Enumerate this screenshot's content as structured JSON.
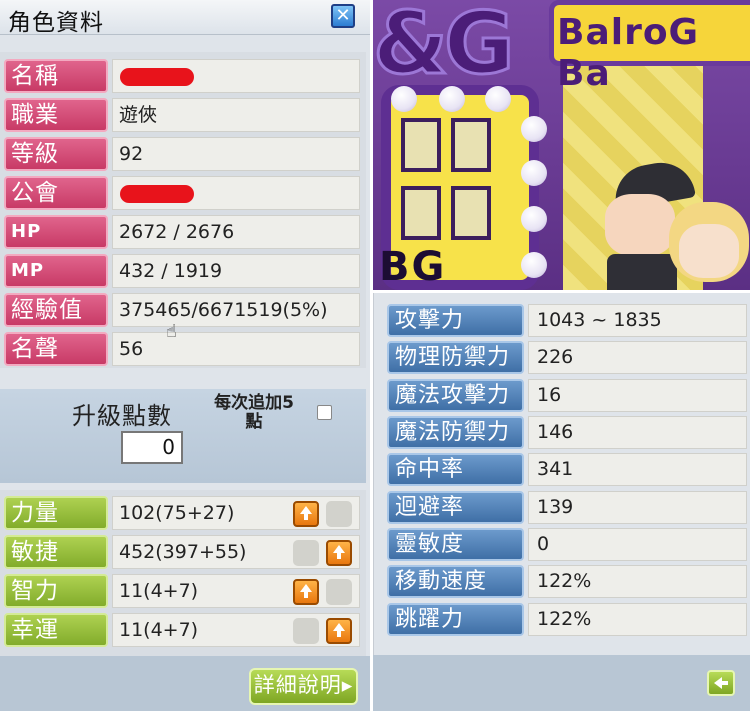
{
  "window": {
    "title": "角色資料"
  },
  "info": [
    {
      "label": "名稱",
      "value": "",
      "redacted": true
    },
    {
      "label": "職業",
      "value": "遊俠"
    },
    {
      "label": "等級",
      "value": "92"
    },
    {
      "label": "公會",
      "value": "",
      "redacted": true
    },
    {
      "label": "HP",
      "value": "2672 / 2676"
    },
    {
      "label": "MP",
      "value": "432 / 1919"
    },
    {
      "label": "經驗值",
      "value": "375465/6671519(5%)"
    },
    {
      "label": "名聲",
      "value": "56"
    }
  ],
  "ability_points": {
    "label": "升級點數",
    "value": "0",
    "add5_label": "每次追加5\n點",
    "add5_checked": false
  },
  "stats": [
    {
      "label": "力量",
      "value": "102(75+27)"
    },
    {
      "label": "敏捷",
      "value": "452(397+55)"
    },
    {
      "label": "智力",
      "value": "11(4+7)"
    },
    {
      "label": "幸運",
      "value": "11(4+7)"
    }
  ],
  "buttons": {
    "detail": "詳細說明▸"
  },
  "scene": {
    "banner": "BalroG Ba",
    "big_letters": "&G",
    "frame_letters": "BG"
  },
  "detail_stats": [
    {
      "label": "攻擊力",
      "value": "1043 ~ 1835"
    },
    {
      "label": "物理防禦力",
      "value": "226"
    },
    {
      "label": "魔法攻擊力",
      "value": "16"
    },
    {
      "label": "魔法防禦力",
      "value": "146"
    },
    {
      "label": "命中率",
      "value": "341"
    },
    {
      "label": "迴避率",
      "value": "139"
    },
    {
      "label": "靈敏度",
      "value": "0"
    },
    {
      "label": "移動速度",
      "value": "122%"
    },
    {
      "label": "跳躍力",
      "value": "122%"
    }
  ],
  "colors": {
    "label_pink": "#d24b76",
    "label_green": "#95bf3a",
    "label_blue": "#5283ba",
    "up_arrow": "#f0891b"
  }
}
